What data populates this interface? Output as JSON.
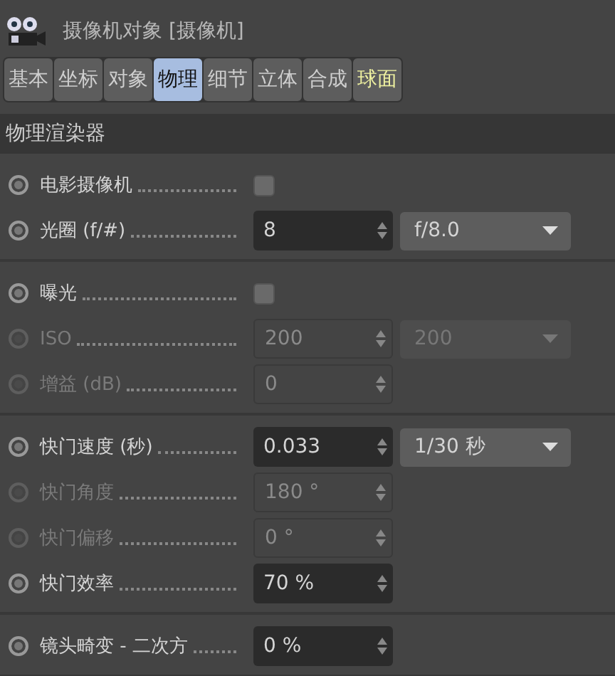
{
  "window": {
    "title": "摄像机对象 [摄像机]"
  },
  "tabs": [
    {
      "label": "基本",
      "selected": false,
      "highlight": false
    },
    {
      "label": "坐标",
      "selected": false,
      "highlight": false
    },
    {
      "label": "对象",
      "selected": false,
      "highlight": false
    },
    {
      "label": "物理",
      "selected": true,
      "highlight": false
    },
    {
      "label": "细节",
      "selected": false,
      "highlight": false
    },
    {
      "label": "立体",
      "selected": false,
      "highlight": false
    },
    {
      "label": "合成",
      "selected": false,
      "highlight": false
    },
    {
      "label": "球面",
      "selected": false,
      "highlight": true
    }
  ],
  "section": {
    "title": "物理渲染器"
  },
  "groups": [
    {
      "rows": [
        {
          "kind": "checkbox",
          "label": "电影摄像机",
          "disabled": false,
          "checked": false
        },
        {
          "kind": "number",
          "label": "光圈 (f/#)",
          "disabled": false,
          "value": "8",
          "dropdown": "f/8.0"
        }
      ]
    },
    {
      "rows": [
        {
          "kind": "checkbox",
          "label": "曝光",
          "disabled": false,
          "checked": false
        },
        {
          "kind": "number",
          "label": "ISO",
          "disabled": true,
          "value": "200",
          "dropdown": "200"
        },
        {
          "kind": "number",
          "label": "增益 (dB)",
          "disabled": true,
          "value": "0"
        }
      ]
    },
    {
      "rows": [
        {
          "kind": "number",
          "label": "快门速度 (秒)",
          "disabled": false,
          "value": "0.033",
          "dropdown": "1/30 秒"
        },
        {
          "kind": "number",
          "label": "快门角度",
          "disabled": true,
          "value": "180 °"
        },
        {
          "kind": "number",
          "label": "快门偏移",
          "disabled": true,
          "value": "0 °"
        },
        {
          "kind": "number",
          "label": "快门效率",
          "disabled": false,
          "value": "70 %"
        }
      ]
    },
    {
      "rows": [
        {
          "kind": "number",
          "label": "镜头畸变 - 二次方",
          "disabled": false,
          "value": "0 %"
        }
      ]
    }
  ]
}
